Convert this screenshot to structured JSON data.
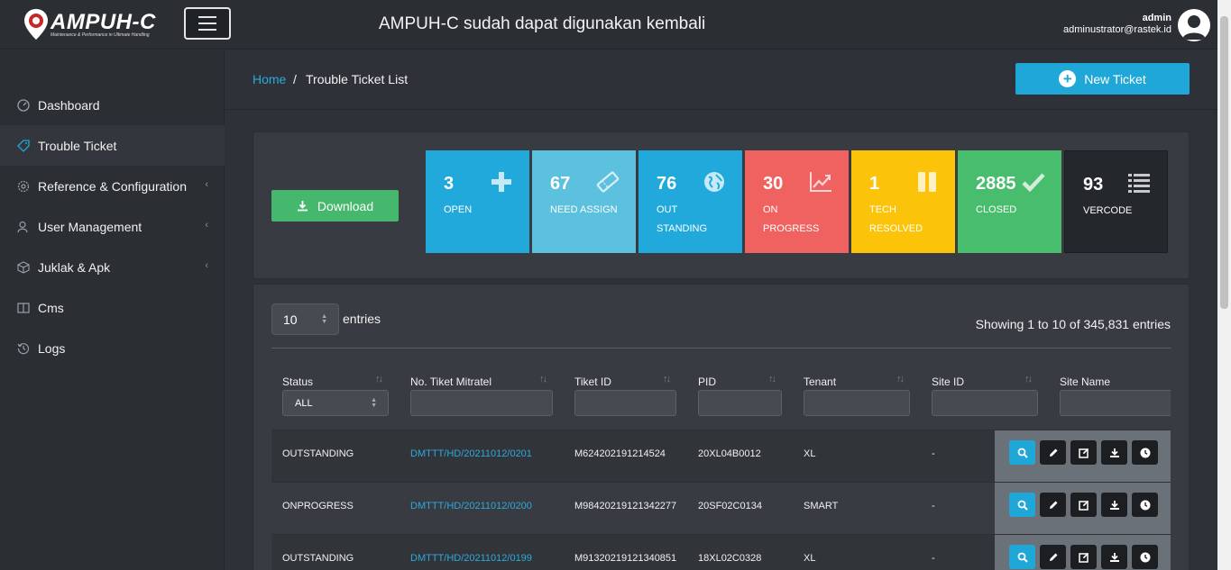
{
  "header": {
    "logo_text": "AMPUH-C",
    "logo_subtitle": "Maintenance & Performance in Ultimate Handling",
    "announcement": "AMPUH-C sudah dapat digunakan kembali",
    "user_name": "admin",
    "user_email": "adminustrator@rastek.id"
  },
  "sidebar": {
    "items": [
      {
        "label": "Dashboard",
        "icon": "gauge-icon"
      },
      {
        "label": "Trouble Ticket",
        "icon": "tag-icon"
      },
      {
        "label": "Reference & Configuration",
        "icon": "gear-icon"
      },
      {
        "label": "User Management",
        "icon": "user-icon"
      },
      {
        "label": "Juklak & Apk",
        "icon": "cube-icon"
      },
      {
        "label": "Cms",
        "icon": "columns-icon"
      },
      {
        "label": "Logs",
        "icon": "history-icon"
      }
    ]
  },
  "breadcrumb": {
    "home": "Home",
    "sep": "/",
    "current": "Trouble Ticket List"
  },
  "new_ticket_label": "New Ticket",
  "download_label": "Download",
  "stats": [
    {
      "num": "3",
      "label": "OPEN",
      "color": "#21a9db",
      "icon": "plus-icon"
    },
    {
      "num": "67",
      "label": "NEED ASSIGN",
      "color": "#5cc0df",
      "icon": "ticket-icon"
    },
    {
      "num": "76",
      "label": "OUT STANDING",
      "color": "#21a9db",
      "icon": "globe-icon"
    },
    {
      "num": "30",
      "label": "ON PROGRESS",
      "color": "#f0625f",
      "icon": "chart-icon"
    },
    {
      "num": "1",
      "label": "TECH RESOLVED",
      "color": "#fbc30a",
      "icon": "pause-icon"
    },
    {
      "num": "2885",
      "label": "CLOSED",
      "color": "#48bd6d",
      "icon": "check-icon"
    },
    {
      "num": "93",
      "label": "VERCODE",
      "color": "#24272b",
      "icon": "list-icon"
    }
  ],
  "table": {
    "length_value": "10",
    "entries_label": "entries",
    "showing": "Showing 1 to 10 of 345,831 entries",
    "headers": [
      "Status",
      "No. Tiket Mitratel",
      "Tiket ID",
      "PID",
      "Tenant",
      "Site ID",
      "Site Name"
    ],
    "status_filter": "ALL",
    "rows": [
      {
        "status": "OUTSTANDING",
        "no_tiket": "DMTTT/HD/20211012/0201",
        "tiket_id": "M624202191214524",
        "pid": "20XL04B0012",
        "tenant": "XL",
        "site_id": "-"
      },
      {
        "status": "ONPROGRESS",
        "no_tiket": "DMTTT/HD/20211012/0200",
        "tiket_id": "M98420219121342277",
        "pid": "20SF02C0134",
        "tenant": "SMART",
        "site_id": "-"
      },
      {
        "status": "OUTSTANDING",
        "no_tiket": "DMTTT/HD/20211012/0199",
        "tiket_id": "M91320219121340851",
        "pid": "18XL02C0328",
        "tenant": "XL",
        "site_id": "-"
      }
    ]
  }
}
